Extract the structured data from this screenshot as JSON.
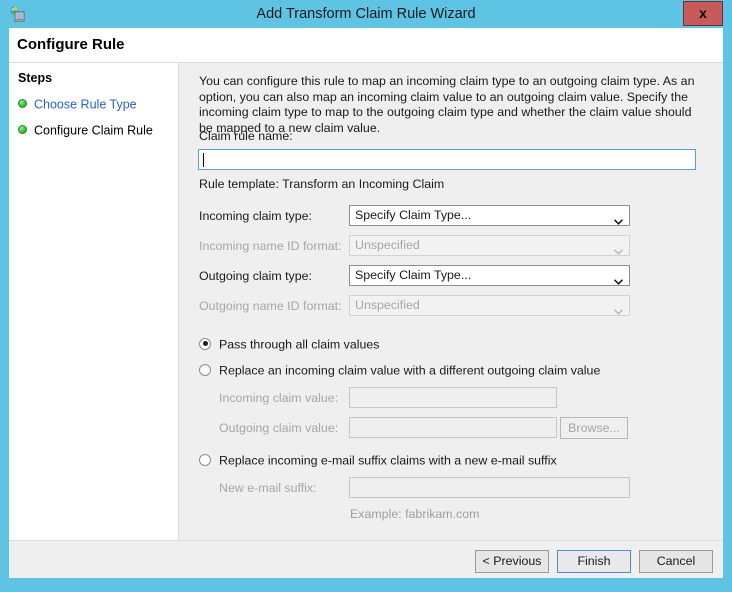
{
  "window": {
    "title": "Add Transform Claim Rule Wizard",
    "icon": "wizard-network-icon",
    "close_label": "x",
    "accent_color": "#5fc3e4"
  },
  "header": {
    "page_title": "Configure Rule"
  },
  "sidebar": {
    "title": "Steps",
    "items": [
      {
        "label": "Choose Rule Type",
        "state": "link",
        "bullet": "green-dot-icon"
      },
      {
        "label": "Configure Claim Rule",
        "state": "current",
        "bullet": "green-dot-icon"
      }
    ]
  },
  "content": {
    "description": "You can configure this rule to map an incoming claim type to an outgoing claim type. As an option, you can also map an incoming claim value to an outgoing claim value. Specify the incoming claim type to map to the outgoing claim type and whether the claim value should be mapped to a new claim value.",
    "rule_name": {
      "label": "Claim rule name:",
      "value": "",
      "placeholder": ""
    },
    "rule_template": "Rule template: Transform an Incoming Claim",
    "fields": [
      {
        "label": "Incoming claim type:",
        "value": "Specify Claim Type...",
        "enabled": true,
        "kind": "combobox"
      },
      {
        "label": "Incoming name ID format:",
        "value": "Unspecified",
        "enabled": false,
        "kind": "combobox"
      },
      {
        "label": "Outgoing claim type:",
        "value": "Specify Claim Type...",
        "enabled": true,
        "kind": "combobox"
      },
      {
        "label": "Outgoing name ID format:",
        "value": "Unspecified",
        "enabled": false,
        "kind": "combobox"
      }
    ],
    "options": [
      {
        "label": "Pass through all claim values",
        "selected": true
      },
      {
        "label": "Replace an incoming claim value with a different outgoing claim value",
        "selected": false
      },
      {
        "label": "Replace incoming e-mail suffix claims with a new e-mail suffix",
        "selected": false
      }
    ],
    "incoming_claim_value": {
      "label": "Incoming claim value:",
      "value": "",
      "enabled": false
    },
    "outgoing_claim_value": {
      "label": "Outgoing claim value:",
      "value": "",
      "enabled": false
    },
    "browse_label": "Browse...",
    "new_email_suffix": {
      "label": "New e-mail suffix:",
      "value": "",
      "enabled": false
    },
    "email_example": "Example: fabrikam.com"
  },
  "footer": {
    "previous_label": "< Previous",
    "finish_label": "Finish",
    "cancel_label": "Cancel"
  }
}
